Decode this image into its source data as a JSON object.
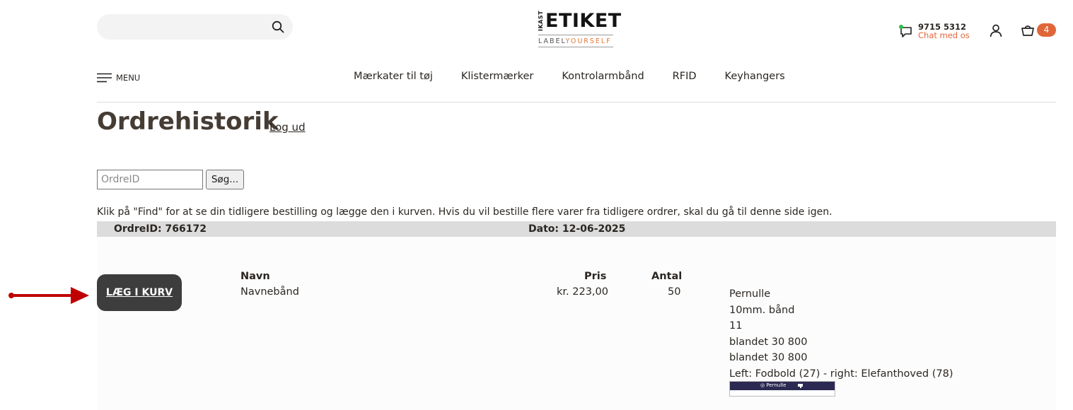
{
  "header": {
    "search_placeholder": "",
    "logo": {
      "side": "IKAST",
      "main": "ETIKET",
      "tag_a": "LABEL",
      "tag_b": "YOURSELF"
    },
    "phone": "9715 5312",
    "chat_label": "Chat med os",
    "cart_count": "4"
  },
  "nav": {
    "menu_label": "MENU",
    "items": [
      "Mærkater til tøj",
      "Klistermærker",
      "Kontrolarmbånd",
      "RFID",
      "Keyhangers"
    ]
  },
  "page": {
    "title": "Ordrehistorik",
    "logout": "Log ud",
    "order_input_placeholder": "OrdreID",
    "search_button": "Søg...",
    "info": "Klik på \"Find\" for at se din tidligere bestilling og lægge den i kurven. Hvis du vil bestille flere varer fra tidligere ordrer, skal du gå til denne side igen."
  },
  "order": {
    "id_label": "OrdreID: 766172",
    "date_label": "Dato: 12-06-2025",
    "add_to_cart": "LÆG I KURV",
    "columns": {
      "name": "Navn",
      "price": "Pris",
      "quantity": "Antal"
    },
    "item": {
      "name": "Navnebånd",
      "price": "kr. 223,00",
      "quantity": "50",
      "details": [
        "Pernulle",
        "10mm. bånd",
        "11",
        "blandet 30 800",
        "blandet 30 800",
        "Left: Fodbold (27) - right: Elefanthoved (78)"
      ],
      "preview_text": "Pernulle"
    }
  },
  "colors": {
    "accent": "#e0663a",
    "button_dark": "#3d3d3d",
    "arrow": "#c00000",
    "label_bg": "#2c2a52"
  }
}
